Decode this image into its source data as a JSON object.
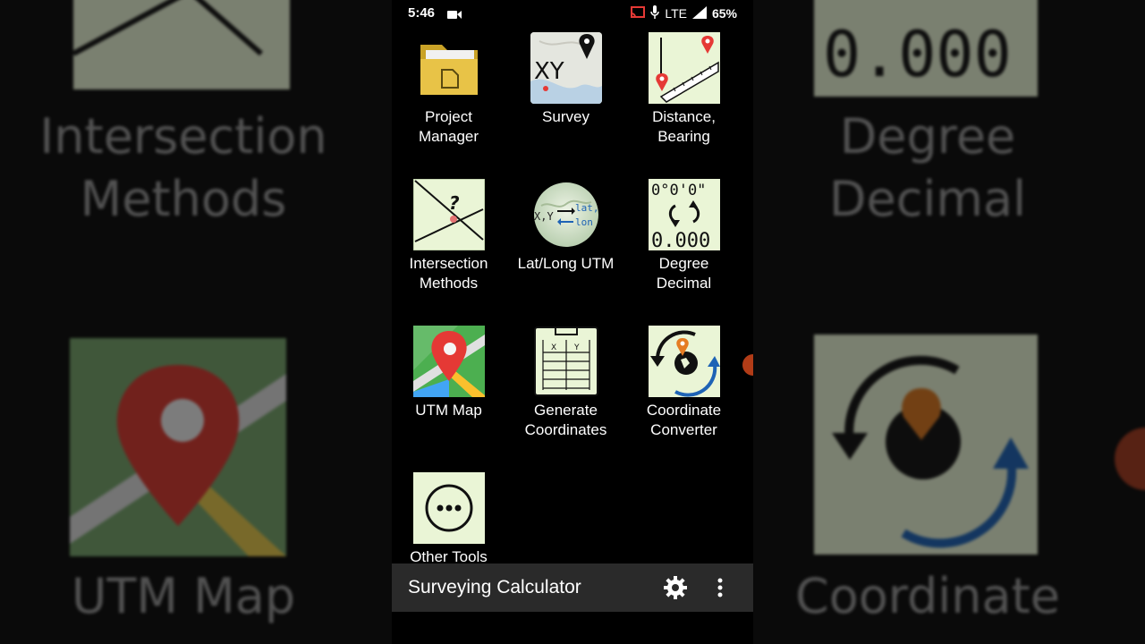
{
  "status_bar": {
    "time": "5:46",
    "network": "LTE",
    "battery": "65%"
  },
  "apps": [
    {
      "label_line1": "Project",
      "label_line2": "Manager",
      "icon": "folder-icon"
    },
    {
      "label_line1": "Survey",
      "label_line2": "",
      "icon": "survey-map-icon",
      "icon_text": "XY"
    },
    {
      "label_line1": "Distance,",
      "label_line2": "Bearing",
      "icon": "distance-bearing-icon"
    },
    {
      "label_line1": "Intersection",
      "label_line2": "Methods",
      "icon": "intersection-icon",
      "icon_text": "?"
    },
    {
      "label_line1": "Lat/Long UTM",
      "label_line2": "",
      "icon": "globe-latlong-icon",
      "icon_text_a": "X,Y",
      "icon_text_b": "lat,",
      "icon_text_c": "lon"
    },
    {
      "label_line1": "Degree",
      "label_line2": "Decimal",
      "icon": "degree-decimal-icon",
      "icon_text_a": "0°0'0\"",
      "icon_text_b": "0.000"
    },
    {
      "label_line1": "UTM Map",
      "label_line2": "",
      "icon": "map-pin-icon"
    },
    {
      "label_line1": "Generate",
      "label_line2": "Coordinates",
      "icon": "clipboard-icon",
      "icon_text_a": "X",
      "icon_text_b": "Y"
    },
    {
      "label_line1": "Coordinate",
      "label_line2": "Converter",
      "icon": "coordinate-converter-icon"
    },
    {
      "label_line1": "Other Tools",
      "label_line2": "",
      "icon": "more-tools-icon"
    }
  ],
  "bottom_bar": {
    "title": "Surveying Calculator",
    "settings_icon": "gear-icon",
    "menu_icon": "more-vert-icon"
  },
  "background": {
    "left_top_text_1": "Intersection",
    "left_top_text_2": "Methods",
    "left_bottom_text": "UTM Map",
    "right_top_value": "0.000",
    "right_top_text_1": "Degree",
    "right_top_text_2": "Decimal",
    "right_bottom_text": "Coordinate"
  },
  "colors": {
    "tile_bg": "#eaf5d6",
    "bar_bg": "#2a2a2a",
    "pin_red": "#e53935",
    "folder_yellow": "#e8c347"
  }
}
